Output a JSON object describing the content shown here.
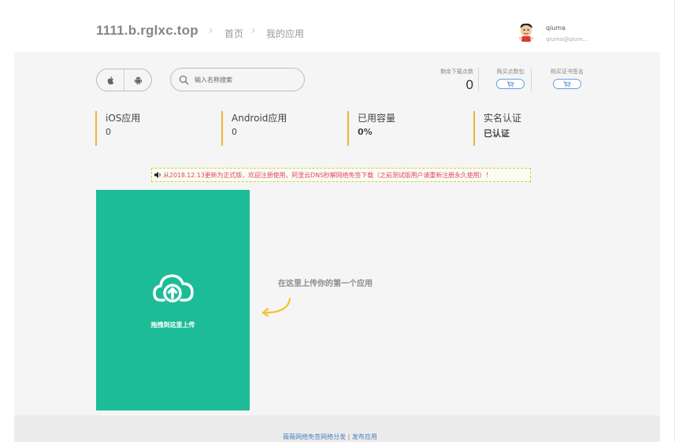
{
  "header": {
    "site_title": "1111.b.rglxc.top",
    "breadcrumb": [
      "首页",
      "我的应用"
    ],
    "user": {
      "name": "qiuma",
      "email": "qiuma@qium..."
    }
  },
  "toolbar": {
    "platforms": [
      "apple-icon",
      "android-icon"
    ],
    "search_placeholder": "输入名称搜索",
    "downloads_label": "剩余下载点数",
    "downloads_value": "0",
    "buy_downloads_label": "购买点数包",
    "buy_cert_label": "购买证书签名"
  },
  "info": [
    {
      "title": "iOS应用",
      "value": "0",
      "bold": false
    },
    {
      "title": "Android应用",
      "value": "0",
      "bold": false
    },
    {
      "title": "已用容量",
      "value": "0%",
      "bold": true
    },
    {
      "title": "实名认证",
      "value": "已认证",
      "bold": true
    }
  ],
  "notice": "从2018.12.13更新为正式版，欢迎注册使用，阿里云DNS秒解网络免签下载（之前测试版用户请重新注册永久使用）！",
  "upload": {
    "label": "拖拽到这里上传",
    "hint": "在这里上传你的第一个应用",
    "bg_color": "#1dbc98"
  },
  "footer": {
    "link1": "薇薇网络免签网络分发",
    "separator": "|",
    "link2": "发布应用"
  }
}
